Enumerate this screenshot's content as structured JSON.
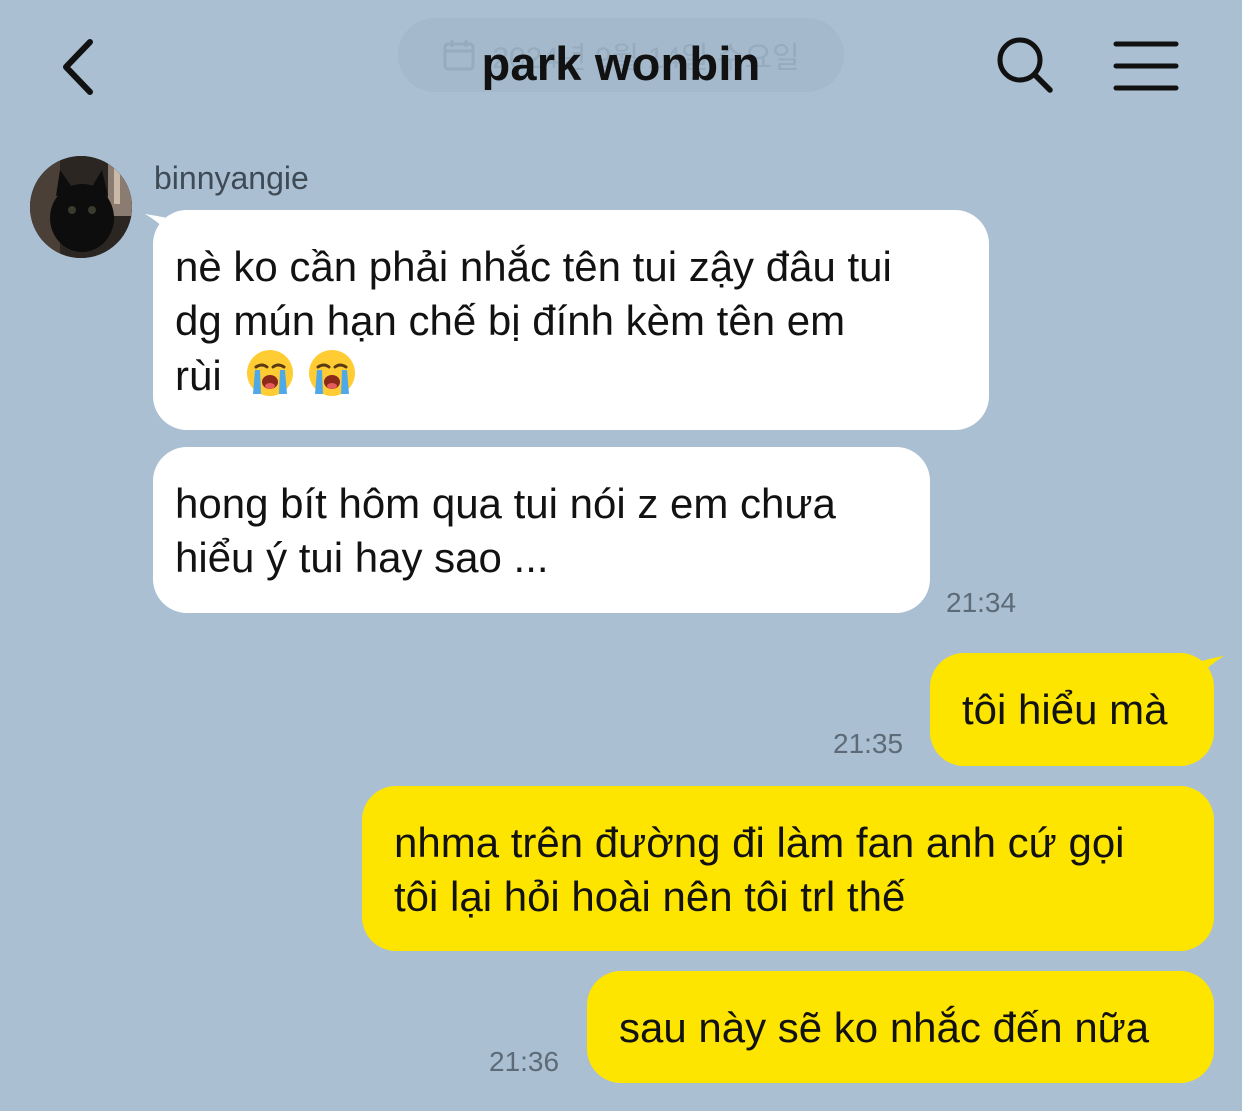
{
  "header": {
    "title": "park wonbin",
    "date_pill": "2024년 9월 14일 수요일",
    "back_icon": "chevron-left-icon",
    "search_icon": "search-icon",
    "menu_icon": "hamburger-menu-icon"
  },
  "colors": {
    "background": "#aabfd1",
    "incoming_bubble": "#ffffff",
    "outgoing_bubble": "#fee500"
  },
  "messages": {
    "sender_name": "binnyangie",
    "m1": {
      "line1": "nè ko cần phải nhắc tên tui zậy đâu tui",
      "line2": "dg mún hạn chế bị đính kèm tên em",
      "line3": "rùi",
      "emoji": "loudly-crying-face"
    },
    "m2": {
      "line1": "hong bít hôm qua tui nói z em chưa",
      "line2": "hiểu ý tui hay sao ...",
      "time": "21:34"
    },
    "m3": {
      "text": "tôi hiểu mà",
      "time": "21:35"
    },
    "m4": {
      "line1": "nhma trên đường đi làm fan anh cứ gọi",
      "line2": "tôi lại hỏi hoài nên tôi trl thế"
    },
    "m5": {
      "text": "sau này sẽ ko nhắc đến nữa",
      "time": "21:36"
    }
  }
}
